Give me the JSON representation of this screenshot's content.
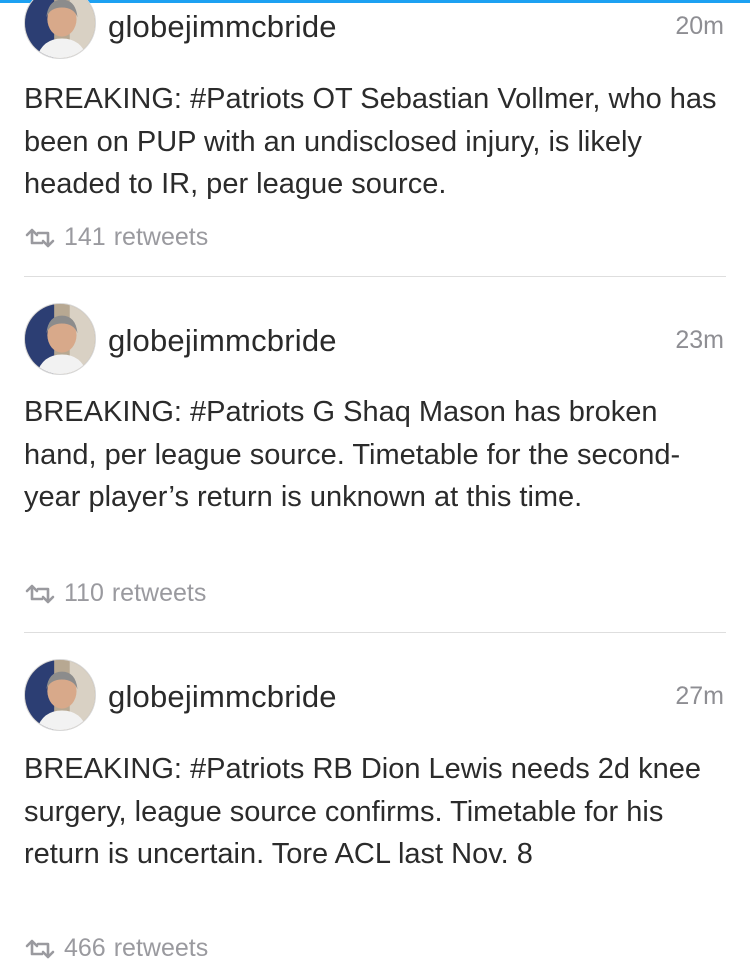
{
  "colors": {
    "accent": "#1da1f2",
    "text": "#2b2b2b",
    "muted": "#9a9a9f",
    "divider": "#dedede"
  },
  "tweets": [
    {
      "username": "globejimmcbride",
      "time": "20m",
      "text": "BREAKING: #Patriots OT Sebastian Vollmer, who has been on PUP with an undisclosed injury, is likely headed to IR, per league source.",
      "retweet_count": "141",
      "retweet_label": "retweets",
      "icon": "retweet-icon"
    },
    {
      "username": "globejimmcbride",
      "time": "23m",
      "text": "BREAKING: #Patriots G Shaq Mason has broken hand, per league source. Timetable for the second-year player’s return is unknown at this time.",
      "retweet_count": "110",
      "retweet_label": "retweets",
      "icon": "retweet-icon"
    },
    {
      "username": "globejimmcbride",
      "time": "27m",
      "text": "BREAKING: #Patriots RB Dion Lewis needs 2d knee surgery, league source confirms. Timetable for his return is uncertain. Tore ACL last Nov. 8",
      "retweet_count": "466",
      "retweet_label": "retweets",
      "icon": "retweet-icon"
    }
  ]
}
